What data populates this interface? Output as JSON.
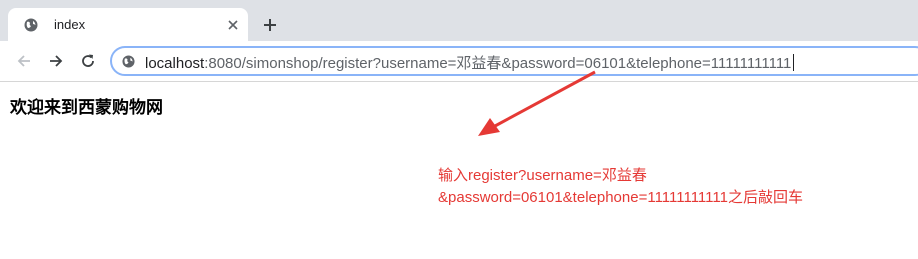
{
  "tab": {
    "title": "index",
    "favicon": "globe-icon",
    "close_icon": "close-icon",
    "new_tab_icon": "plus-icon"
  },
  "toolbar": {
    "back_icon": "arrow-left-icon",
    "forward_icon": "arrow-right-icon",
    "reload_icon": "reload-icon"
  },
  "address_bar": {
    "icon": "info-icon",
    "host": "localhost",
    "rest": ":8080/simonshop/register?username=邓益春&password=06101&telephone=11111111111"
  },
  "page": {
    "heading": "欢迎来到西蒙购物网"
  },
  "annotation": {
    "line1": "输入register?username=邓益春",
    "line2": "&password=06101&telephone=11111111111之后敲回车",
    "color": "#e53935"
  }
}
